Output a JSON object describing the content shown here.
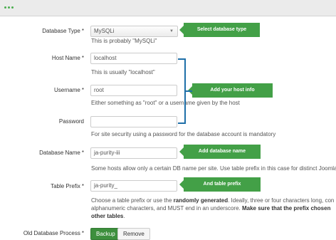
{
  "fields": {
    "db_type": {
      "label": "Database Type",
      "value": "MySQLi",
      "help": "This is probably \"MySQLi\"",
      "callout": "Select database type"
    },
    "host": {
      "label": "Host Name",
      "value": "localhost",
      "help": "This is usually \"localhost\""
    },
    "username": {
      "label": "Username",
      "value": "root",
      "help": "Either something as \"root\" or a username given by the host",
      "callout": "Add your host info"
    },
    "password": {
      "label": "Password",
      "value": "",
      "help": "For site security using a password for the database account is mandatory"
    },
    "db_name": {
      "label": "Database Name",
      "value": "ja-purity-iii",
      "help": "Some hosts allow only a certain DB name per site. Use table prefix in this case for distinct Joomla!",
      "callout": "Add database name"
    },
    "prefix": {
      "label": "Table Prefix",
      "value": "ja-purity_",
      "help_line1_pre": "Choose a table prefix or use the ",
      "help_line1_bold": "randomly generated",
      "help_line1_post": ". Ideally, three or four characters long, con",
      "help_line2_pre": "alphanumeric characters, and MUST end in an underscore. ",
      "help_line2_bold": "Make sure that the prefix chosen",
      "help_line3_bold": "other tables",
      "help_line3_post": ".",
      "callout": "And table prefix"
    }
  },
  "old_db": {
    "label": "Old Database Process",
    "backup_label": "Backup",
    "remove_label": "Remove"
  },
  "required_mark": "*",
  "colors": {
    "callout": "#43a047",
    "bracket": "#1e6fa8",
    "active_button": "#3d8f3d"
  }
}
